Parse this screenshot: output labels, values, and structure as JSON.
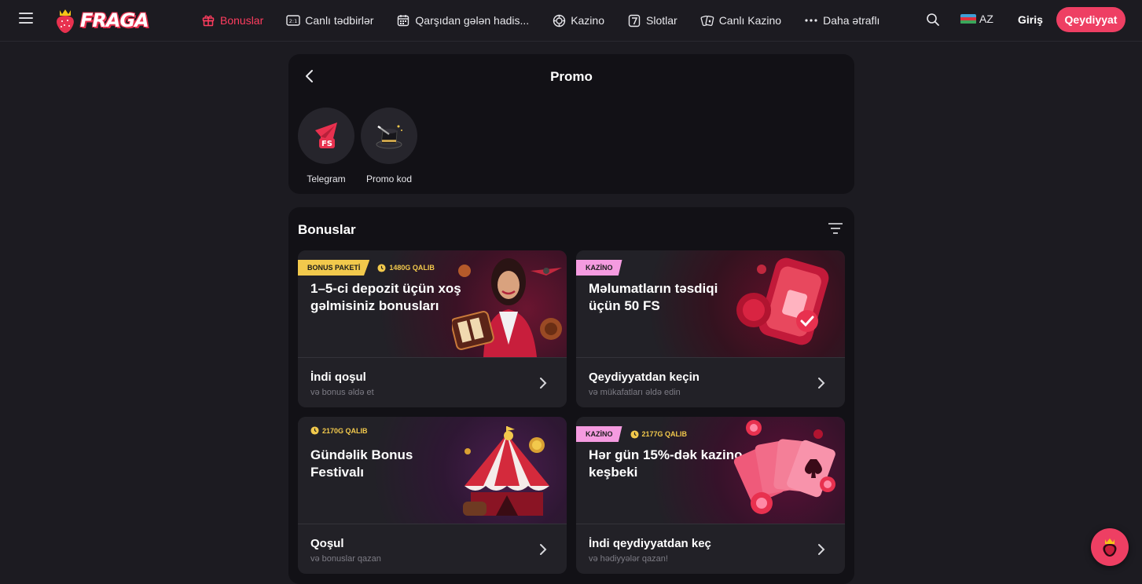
{
  "header": {
    "logo_text": "FRAGA",
    "nav": [
      {
        "label": "Bonuslar",
        "icon": "gift-icon",
        "active": true
      },
      {
        "label": "Canlı tədbirlər",
        "icon": "live-scoreboard-icon"
      },
      {
        "label": "Qarşıdan gələn hadis...",
        "icon": "calendar-icon"
      },
      {
        "label": "Kazino",
        "icon": "casino-chip-icon"
      },
      {
        "label": "Slotlar",
        "icon": "slot-seven-icon"
      },
      {
        "label": "Canlı Kazino",
        "icon": "playing-cards-icon"
      },
      {
        "label": "Daha ətraflı",
        "icon": "more-dots-icon"
      }
    ],
    "language": "AZ",
    "login_label": "Giriş",
    "register_label": "Qeydiyyat"
  },
  "promo": {
    "title": "Promo",
    "items": [
      {
        "label": "Telegram",
        "icon": "telegram-fs-icon"
      },
      {
        "label": "Promo kod",
        "icon": "magic-hat-icon"
      }
    ]
  },
  "bonuses": {
    "title": "Bonuslar",
    "cards": [
      {
        "tag": "BONUS PAKETİ",
        "wager": "1480G QALIB",
        "title": "1–5-ci depozit üçün xoş gəlmisiniz bonusları",
        "cta_title": "İndi qoşul",
        "cta_sub": "və bonus əldə et",
        "art": "casino-hostess-illustration"
      },
      {
        "tag": "KAZİNO",
        "wager": "",
        "title": "Məlumatların təsdiqi üçün 50 FS",
        "cta_title": "Qeydiyyatdan keçin",
        "cta_sub": "və mükafatları əldə edin",
        "art": "phone-sim-illustration"
      },
      {
        "tag": "",
        "wager": "2170G QALIB",
        "title": "Gündəlik Bonus Festivalı",
        "cta_title": "Qoşul",
        "cta_sub": "və bonuslar qazan",
        "art": "circus-tent-illustration"
      },
      {
        "tag": "KAZİNO",
        "wager": "2177G QALIB",
        "title": "Hər gün 15%-dək kazino keşbeki",
        "cta_title": "İndi qeydiyyatdan keç",
        "cta_sub": "və hədiyyələr qazan!",
        "art": "cards-chips-illustration"
      }
    ]
  },
  "colors": {
    "accent": "#ee3f63",
    "background": "#1c1b21",
    "panel": "#121116",
    "card": "#222127",
    "tag_yellow": "#f2c94c",
    "tag_pink": "#f59be0"
  }
}
